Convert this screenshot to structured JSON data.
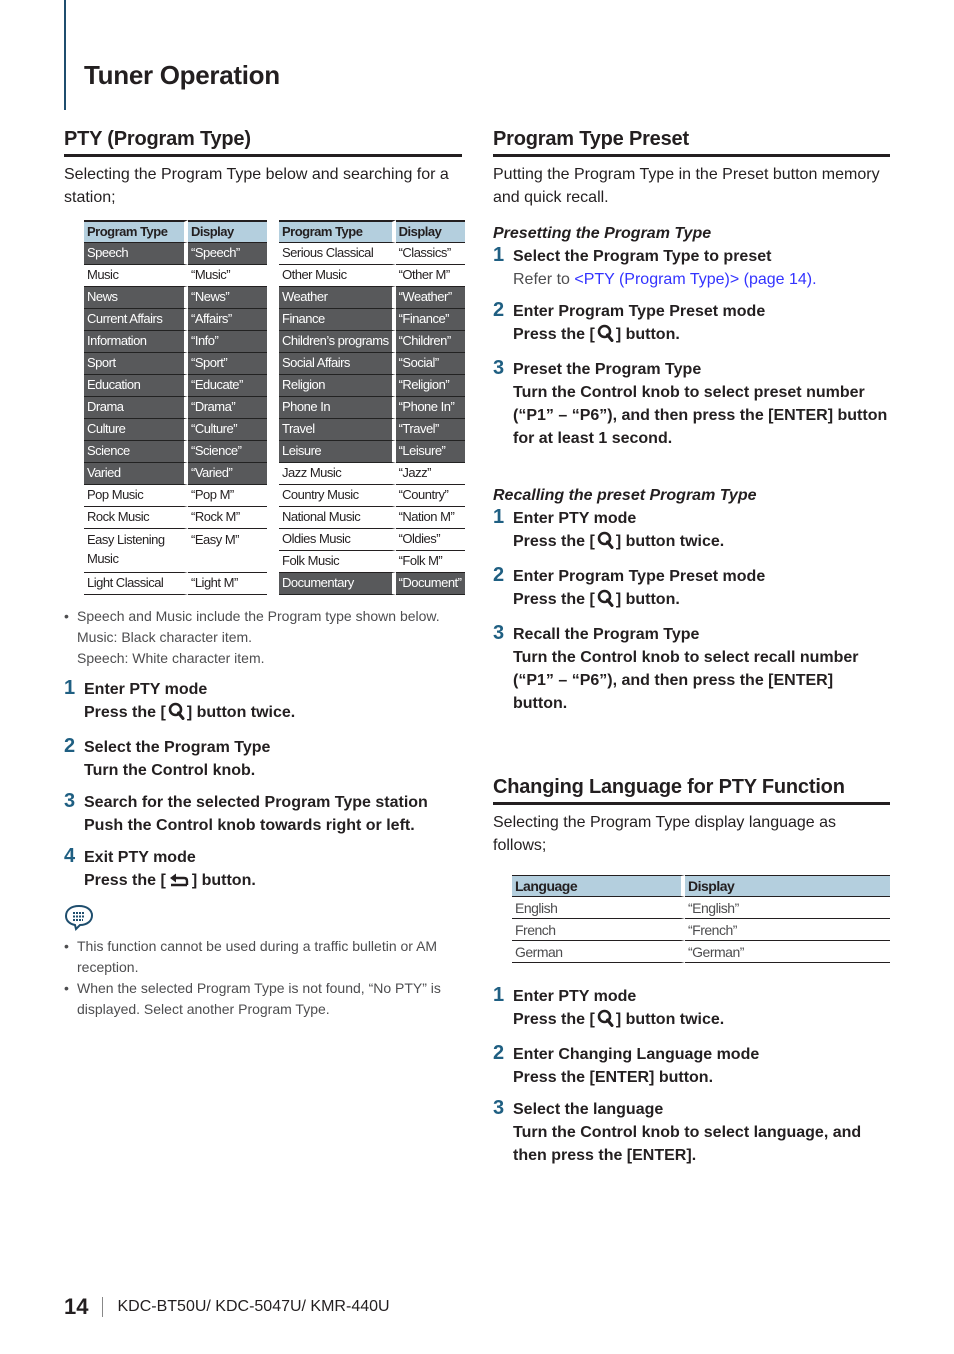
{
  "page": {
    "title": "Tuner Operation",
    "page_number": "14",
    "footer_model": "KDC-BT50U/ KDC-5047U/ KMR-440U"
  },
  "pty": {
    "title": "PTY (Program Type)",
    "intro": "Selecting the Program Type below and searching for a station;",
    "table_headers": [
      "Program Type",
      "Display"
    ],
    "left_rows": [
      {
        "type": "Speech",
        "display": "“Speech”",
        "category": "speech"
      },
      {
        "type": "Music",
        "display": "“Music”",
        "category": "music"
      },
      {
        "type": "News",
        "display": "“News”",
        "category": "speech"
      },
      {
        "type": "Current Affairs",
        "display": "“Affairs”",
        "category": "speech"
      },
      {
        "type": "Information",
        "display": "“Info”",
        "category": "speech"
      },
      {
        "type": "Sport",
        "display": "“Sport”",
        "category": "speech"
      },
      {
        "type": "Education",
        "display": "“Educate”",
        "category": "speech"
      },
      {
        "type": "Drama",
        "display": "“Drama”",
        "category": "speech"
      },
      {
        "type": "Culture",
        "display": "“Culture”",
        "category": "speech"
      },
      {
        "type": "Science",
        "display": "“Science”",
        "category": "speech"
      },
      {
        "type": "Varied",
        "display": "“Varied”",
        "category": "speech"
      },
      {
        "type": "Pop Music",
        "display": "“Pop M”",
        "category": "music"
      },
      {
        "type": "Rock Music",
        "display": "“Rock M”",
        "category": "music"
      },
      {
        "type": "Easy Listening Music",
        "display": "“Easy M”",
        "category": "music"
      },
      {
        "type": "Light Classical",
        "display": "“Light M”",
        "category": "music"
      }
    ],
    "right_rows": [
      {
        "type": "Serious Classical",
        "display": "“Classics”",
        "category": "music"
      },
      {
        "type": "Other Music",
        "display": "“Other M”",
        "category": "music"
      },
      {
        "type": "Weather",
        "display": "“Weather”",
        "category": "speech"
      },
      {
        "type": "Finance",
        "display": "“Finance”",
        "category": "speech"
      },
      {
        "type": "Children’s programs",
        "display": "“Children”",
        "category": "speech"
      },
      {
        "type": "Social Affairs",
        "display": "“Social”",
        "category": "speech"
      },
      {
        "type": "Religion",
        "display": "“Religion”",
        "category": "speech"
      },
      {
        "type": "Phone In",
        "display": "“Phone In”",
        "category": "speech"
      },
      {
        "type": "Travel",
        "display": "“Travel”",
        "category": "speech"
      },
      {
        "type": "Leisure",
        "display": "“Leisure”",
        "category": "speech"
      },
      {
        "type": "Jazz Music",
        "display": "“Jazz”",
        "category": "music"
      },
      {
        "type": "Country Music",
        "display": "“Country”",
        "category": "music"
      },
      {
        "type": "National Music",
        "display": "“Nation M”",
        "category": "music"
      },
      {
        "type": "Oldies Music",
        "display": "“Oldies”",
        "category": "music"
      },
      {
        "type": "Folk Music",
        "display": "“Folk M”",
        "category": "music"
      },
      {
        "type": "Documentary",
        "display": "“Document”",
        "category": "speech"
      }
    ],
    "note": {
      "line1": "Speech and Music include the Program type shown below.",
      "line2": "Music: Black character item.",
      "line3": "Speech: White character item."
    },
    "steps": [
      {
        "num": "1",
        "title": "Enter PTY mode",
        "body_pre": "Press the [",
        "icon": "search-icon",
        "body_post": "] button twice."
      },
      {
        "num": "2",
        "title": "Select the Program Type",
        "body": "Turn the Control knob."
      },
      {
        "num": "3",
        "title": "Search for the selected Program Type station",
        "body": "Push the Control knob towards right or left."
      },
      {
        "num": "4",
        "title": "Exit PTY mode",
        "body_pre": "Press the [",
        "icon": "return-icon",
        "body_post": "] button."
      }
    ],
    "memo_icon": "memo-icon",
    "notes": [
      "This function cannot be used during a traffic bulletin or AM reception.",
      "When the selected Program Type is not found, “No PTY” is displayed. Select another Program Type."
    ]
  },
  "preset": {
    "title": "Program Type Preset",
    "intro": "Putting the Program Type in the Preset button memory and quick recall.",
    "presetting": {
      "heading": "Presetting the Program Type",
      "steps": [
        {
          "num": "1",
          "title": "Select the Program Type to preset",
          "body_pre": "Refer to ",
          "link": "<PTY (Program Type)> (page 14)."
        },
        {
          "num": "2",
          "title": "Enter Program Type Preset mode",
          "body_pre": "Press the [",
          "icon": "search-icon",
          "body_post": "] button."
        },
        {
          "num": "3",
          "title": "Preset the Program Type",
          "body": "Turn the Control knob to select preset number (“P1” – “P6”), and then press the [ENTER] button for at least 1 second."
        }
      ]
    },
    "recalling": {
      "heading": "Recalling the preset Program Type",
      "steps": [
        {
          "num": "1",
          "title": "Enter PTY mode",
          "body_pre": "Press the [",
          "icon": "search-icon",
          "body_post": "] button twice."
        },
        {
          "num": "2",
          "title": "Enter Program Type Preset mode",
          "body_pre": "Press the [",
          "icon": "search-icon",
          "body_post": "] button."
        },
        {
          "num": "3",
          "title": "Recall the Program Type",
          "body": "Turn the Control knob to select recall number (“P1” – “P6”), and then press the [ENTER] button."
        }
      ]
    }
  },
  "language": {
    "title": "Changing Language for PTY Function",
    "intro": "Selecting the Program Type display language as follows;",
    "table_headers": [
      "Language",
      "Display"
    ],
    "rows": [
      {
        "language": "English",
        "display": "“English”"
      },
      {
        "language": "French",
        "display": "“French”"
      },
      {
        "language": "German",
        "display": "“German”"
      }
    ],
    "steps": [
      {
        "num": "1",
        "title": "Enter PTY mode",
        "body_pre": "Press the [",
        "icon": "search-icon",
        "body_post": "] button twice."
      },
      {
        "num": "2",
        "title": "Enter Changing Language mode",
        "body": "Press the [ENTER] button."
      },
      {
        "num": "3",
        "title": "Select the language",
        "body": "Turn the Control knob to select language, and then press the [ENTER]."
      }
    ]
  }
}
